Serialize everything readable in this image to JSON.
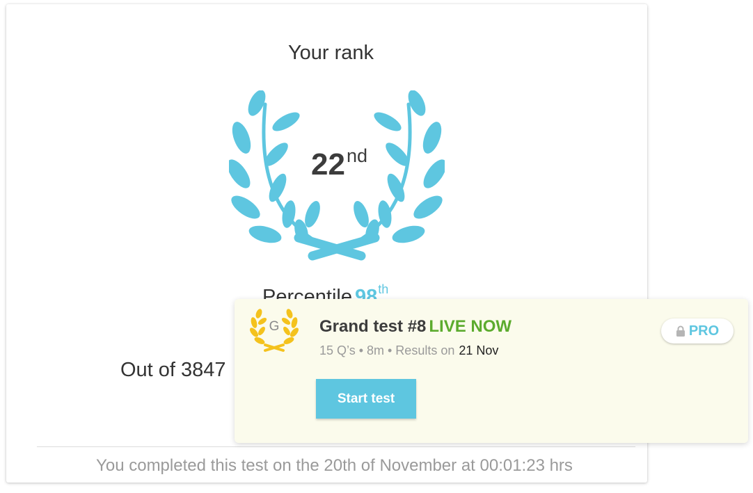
{
  "rank_card": {
    "title": "Your rank",
    "rank_value": "22",
    "rank_suffix": "nd",
    "percentile_label": "Percentile",
    "percentile_value": "98",
    "percentile_suffix": "th",
    "out_of_text": "Out of 3847",
    "completed_text": "You completed this test on the 20th of November at 00:01:23 hrs"
  },
  "test_card": {
    "badge_letter": "G",
    "title": "Grand test #8",
    "status": "LIVE NOW",
    "meta": "15 Q’s • 8m • Results on",
    "results_date": "21 Nov",
    "pro_label": "PRO",
    "start_button_label": "Start test"
  },
  "colors": {
    "accent": "#5ec6e0",
    "live_green": "#5cab2e",
    "gold": "#f4c21d",
    "test_card_bg": "#fbfbec"
  },
  "icons": {
    "laurel": "laurel-wreath-icon",
    "badge": "gold-laurel-badge-icon",
    "lock": "lock-icon"
  }
}
